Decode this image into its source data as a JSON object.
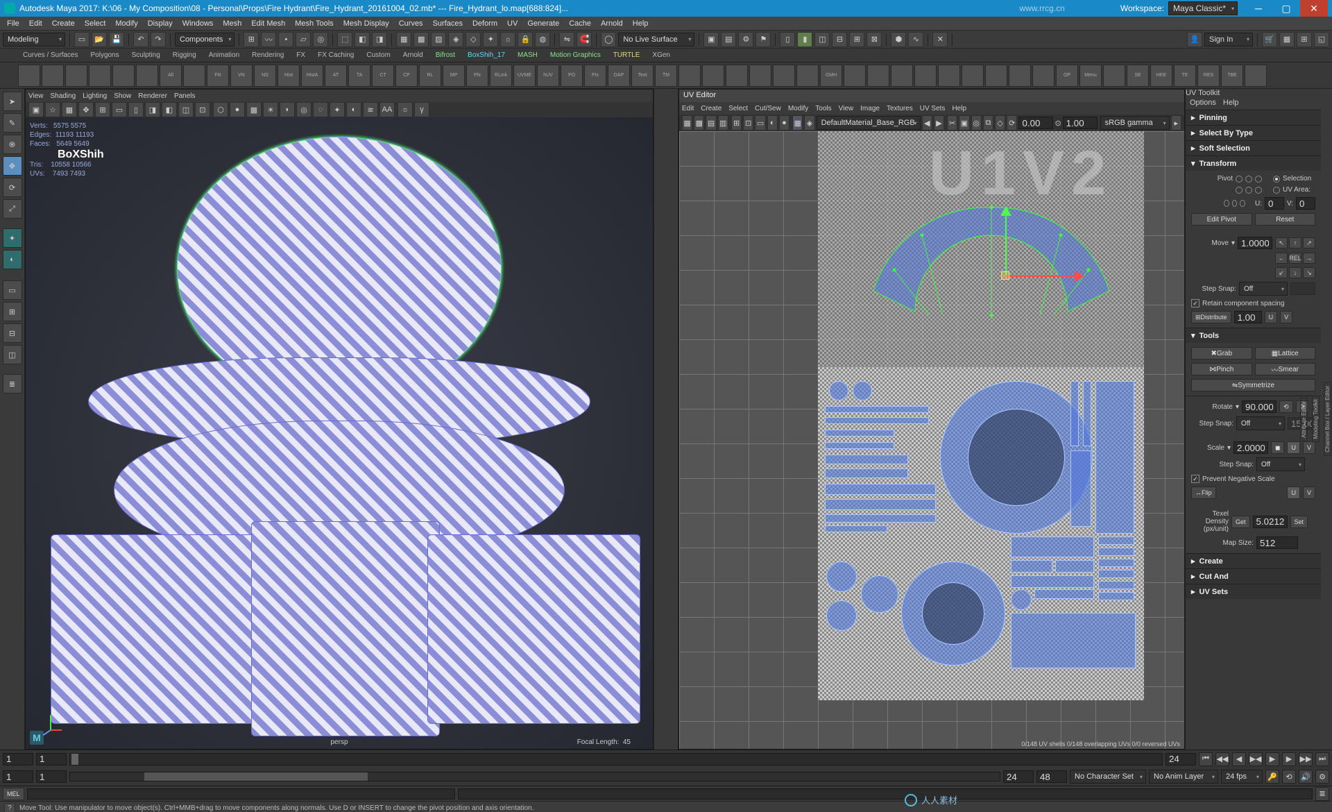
{
  "window": {
    "title": "Autodesk Maya 2017: K:\\06 - My Composition\\08 - Personal\\Props\\Fire Hydrant\\Fire_Hydrant_20161004_02.mb*  ---  Fire_Hydrant_lo.map[688:824]...",
    "url": "www.rrcg.cn",
    "workspace_label": "Workspace:",
    "workspace_value": "Maya Classic*"
  },
  "main_menu": [
    "File",
    "Edit",
    "Create",
    "Select",
    "Modify",
    "Display",
    "Windows",
    "Mesh",
    "Edit Mesh",
    "Mesh Tools",
    "Mesh Display",
    "Curves",
    "Surfaces",
    "Deform",
    "UV",
    "Generate",
    "Cache",
    "Arnold",
    "Help"
  ],
  "mode_switcher": "Modeling",
  "toolbar1": {
    "live_surface": "No Live Surface",
    "signin": "Sign In"
  },
  "shelf_tabs": [
    "Curves / Surfaces",
    "Polygons",
    "Sculpting",
    "Rigging",
    "Animation",
    "Rendering",
    "FX",
    "FX Caching",
    "Custom",
    "Arnold",
    "Bifrost",
    "BoxShih_17",
    "MASH",
    "Motion Graphics",
    "TURTLE",
    "XGen"
  ],
  "shelf_tab_styles": [
    "",
    "",
    "",
    "",
    "",
    "",
    "",
    "",
    "",
    "",
    "green",
    "blue",
    "green",
    "green",
    "yellow",
    ""
  ],
  "shelf_labels": [
    "",
    "",
    "",
    "",
    "",
    "",
    "All",
    "",
    "FN",
    "VN",
    "NS",
    "Hist",
    "HistA",
    "AT",
    "TA",
    "CT",
    "CP",
    "RL",
    "MP",
    "PN",
    "RLink",
    "UVME",
    "hUV",
    "PO",
    "PIx",
    "DAP",
    "Text",
    "TM",
    "",
    "",
    "",
    "",
    "",
    "",
    "GMH",
    "",
    "",
    "",
    "",
    "",
    "",
    "",
    "",
    "",
    "OP",
    "Menu",
    "",
    "SE",
    "HEE",
    "TE",
    "RES",
    "TBE",
    ""
  ],
  "viewport": {
    "menus": [
      "View",
      "Shading",
      "Lighting",
      "Show",
      "Renderer",
      "Panels"
    ],
    "hud": {
      "verts": "5575        5575",
      "edges": "11193      11193",
      "faces": "5649        5649",
      "tris": "10558      10566",
      "uvs": "7493        7493",
      "brand": "BoXShih"
    },
    "cam_label": "persp",
    "focal_label": "Focal Length:",
    "focal_value": "45"
  },
  "uv_editor": {
    "title": "UV Editor",
    "menus": [
      "Edit",
      "Create",
      "Select",
      "Cut/Sew",
      "Modify",
      "Tools",
      "View",
      "Image",
      "Textures",
      "UV Sets",
      "Help"
    ],
    "material_dd": "DefaultMaterial_Base_RGB",
    "u_val": "0.00",
    "v_val": "1.00",
    "gamma": "sRGB gamma",
    "tile_label": "U1V2",
    "status": "0/148 UV shells   0/148 overlapping UVs   0/0 reversed UVs"
  },
  "uv_toolkit": {
    "title": "UV Toolkit",
    "top_menus": [
      "Options",
      "Help"
    ],
    "sections": {
      "pinning": "Pinning",
      "select_by_type": "Select By Type",
      "soft_selection": "Soft Selection",
      "transform": "Transform",
      "tools": "Tools",
      "create": "Create",
      "cut_and_sew": "Cut And",
      "uv_sets": "UV Sets"
    },
    "transform": {
      "pivot": "Pivot",
      "selection": "Selection",
      "uv_area": "UV Area:",
      "u_label": "U:",
      "v_label": "V:",
      "u_val": "0",
      "v_val": "0",
      "edit_pivot": "Edit Pivot",
      "reset": "Reset",
      "move": "Move",
      "move_val": "1.0000",
      "step_snap": "Step Snap:",
      "step_snap_val": "Off",
      "retain": "Retain component spacing",
      "distribute": "Distribute",
      "distribute_val": "1.00",
      "u": "U",
      "v": "V",
      "rel": "REL"
    },
    "tools_list": {
      "grab": "Grab",
      "lattice": "Lattice",
      "pinch": "Pinch",
      "smear": "Smear",
      "symmetrize": "Symmetrize"
    },
    "rotate": {
      "label": "Rotate",
      "val": "90.0000",
      "step_snap": "Step Snap:",
      "step_val": "Off",
      "step_num": "15.00"
    },
    "scale": {
      "label": "Scale",
      "val": "2.0000",
      "step_snap": "Step Snap:",
      "step_val": "Off",
      "prevent": "Prevent Negative Scale",
      "flip": "Flip",
      "u": "U",
      "v": "V"
    },
    "texel": {
      "label": "Texel\nDensity\n(px/unit)",
      "get": "Get",
      "val": "5.0212",
      "set": "Set",
      "mapsize_label": "Map Size:",
      "mapsize_val": "512"
    }
  },
  "rightstrip": [
    "Channel Box / Layer Editor",
    "Modeling Toolkit",
    "Attribute Editor"
  ],
  "timeline": {
    "start": "1",
    "end": "24",
    "start2": "1",
    "end2": "24",
    "cur": "1",
    "end_outer": "48",
    "charset": "No Character Set",
    "animlayer": "No Anim Layer",
    "fps": "24 fps"
  },
  "cmdline": {
    "lang": "MEL"
  },
  "helpline": "Move Tool: Use manipulator to move object(s). Ctrl+MMB+drag to move components along normals. Use D or INSERT to change the pivot position and axis orientation.",
  "watermark": "人人素材"
}
